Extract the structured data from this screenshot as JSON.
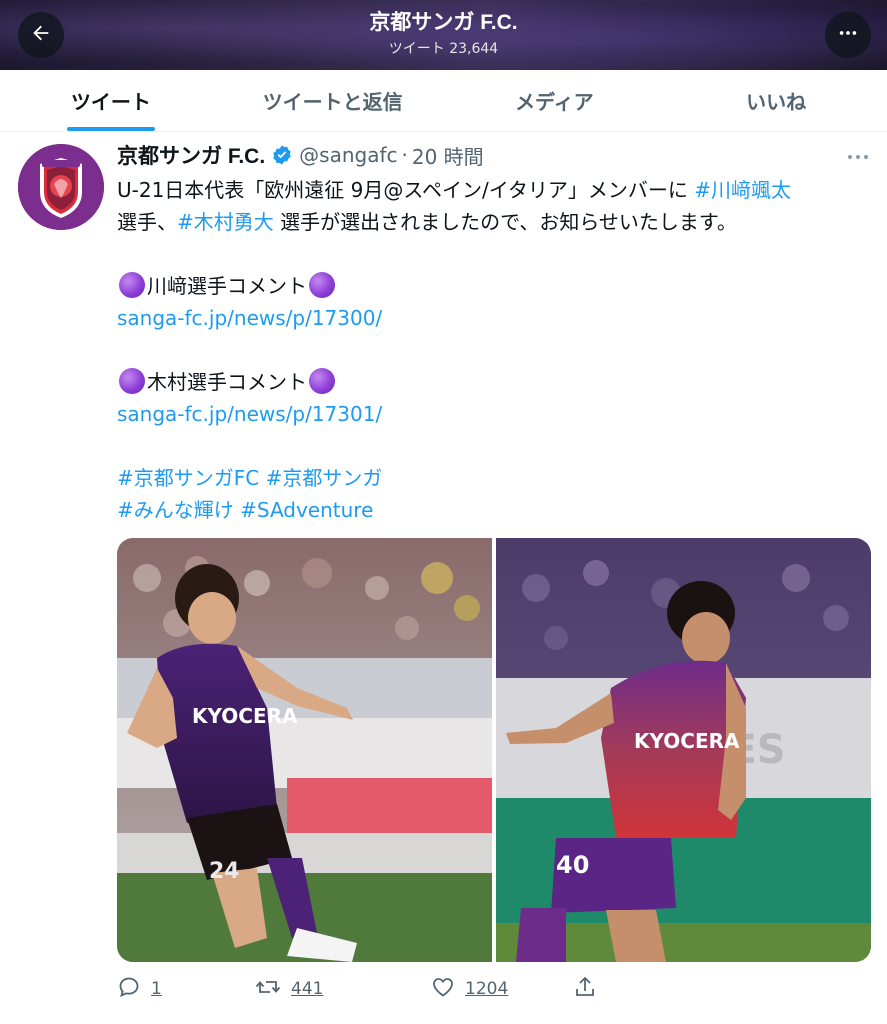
{
  "header": {
    "title": "京都サンガ F.C.",
    "subtitle": "ツイート 23,644",
    "back_icon": "arrow-left-icon",
    "more_icon": "more-horizontal-icon"
  },
  "tabs": [
    {
      "label": "ツイート",
      "active": true
    },
    {
      "label": "ツイートと返信",
      "active": false
    },
    {
      "label": "メディア",
      "active": false
    },
    {
      "label": "いいね",
      "active": false
    }
  ],
  "tweet": {
    "display_name": "京都サンガ F.C.",
    "handle": "@sangafc",
    "separator": "·",
    "time": "20 時間",
    "verified_icon": "verified-badge-icon",
    "body": {
      "l1_text": "U-21日本代表「欧州遠征 9月@スペイン/イタリア」メンバーに ",
      "l1_tag": "#川﨑颯太",
      "l2_text_a": "選手、",
      "l2_tag": "#木村勇大",
      "l2_text_b": " 選手が選出されましたので、お知らせいたします。",
      "comment1": "川﨑選手コメント",
      "link1": "sanga-fc.jp/news/p/17300/",
      "comment2": "木村選手コメント",
      "link2": "sanga-fc.jp/news/p/17301/",
      "tag1": "#京都サンガFC",
      "tag2": "#京都サンガ",
      "tag3": "#みんな輝け",
      "tag4": "#SAdventure"
    },
    "photos": [
      {
        "alt": "player-photo-1",
        "shirt_text": "KYOCERA",
        "number": "24"
      },
      {
        "alt": "player-photo-2",
        "shirt_text": "KYOCERA",
        "number": "40"
      }
    ],
    "stats": {
      "replies": "1",
      "retweets": "441",
      "likes": "1204"
    }
  },
  "colors": {
    "accent": "#1d9bf0",
    "text": "#0f1419",
    "muted": "#536471",
    "sanga_purple": "#6a2c91"
  }
}
